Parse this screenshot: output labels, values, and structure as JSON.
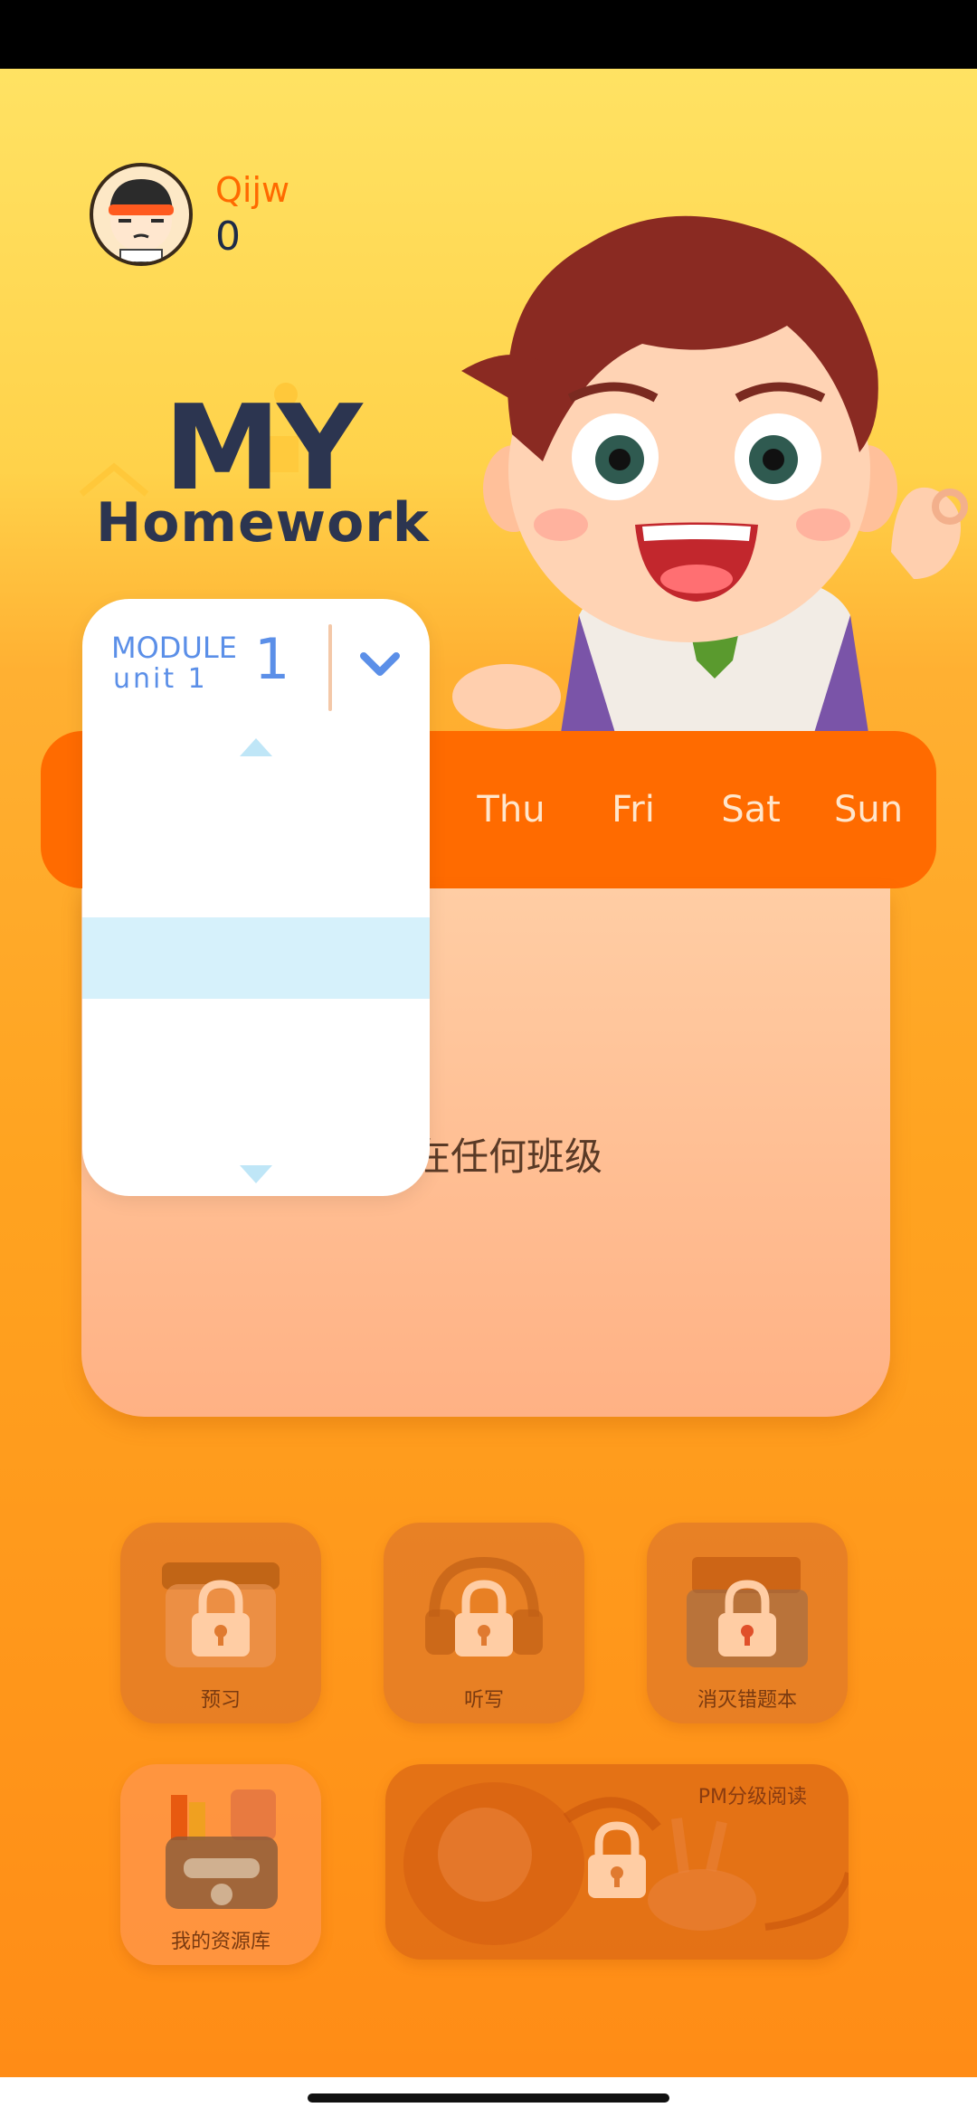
{
  "user": {
    "name": "Qijw",
    "points": "0"
  },
  "logo": {
    "line1": "MY",
    "line2": "Homework"
  },
  "days": [
    "Thu",
    "Fri",
    "Sat",
    "Sun"
  ],
  "dropdown": {
    "module_label": "MODULE",
    "unit_label": "unit 1",
    "selected_number": "1"
  },
  "empty_message": "不在任何班级",
  "tiles": [
    {
      "label": "预习",
      "locked": true
    },
    {
      "label": "听写",
      "locked": true
    },
    {
      "label": "消灭错题本",
      "locked": true
    },
    {
      "label": "我的资源库",
      "locked": false
    },
    {
      "label": "PM分级阅读",
      "locked": true
    }
  ],
  "colors": {
    "accent": "#ff6b00",
    "dropdown_text": "#5b8fe8",
    "selected_row": "#d6f1fb"
  }
}
